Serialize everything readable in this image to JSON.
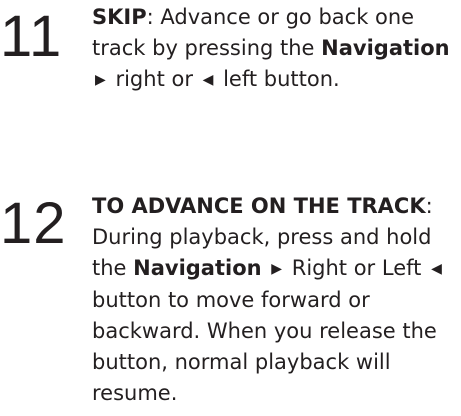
{
  "steps": [
    {
      "number": "11",
      "title": "SKIP",
      "title_suffix": ":",
      "text_1": " Advance or go back one track by pressing the ",
      "nav_label": "Navigation",
      "arrow_right": "▶",
      "text_2": " right or ",
      "arrow_left": "◀",
      "text_3": " left button."
    },
    {
      "number": "12",
      "title": "TO ADVANCE ON THE TRACK",
      "title_suffix": ":",
      "text_1": " During playback, press and hold the ",
      "nav_label": "Navigation",
      "arrow_right": "▶",
      "text_2": " Right or Left ",
      "arrow_left": "◀",
      "text_3": " button to move forward or backward. When you release the button, normal playback will resume."
    }
  ]
}
